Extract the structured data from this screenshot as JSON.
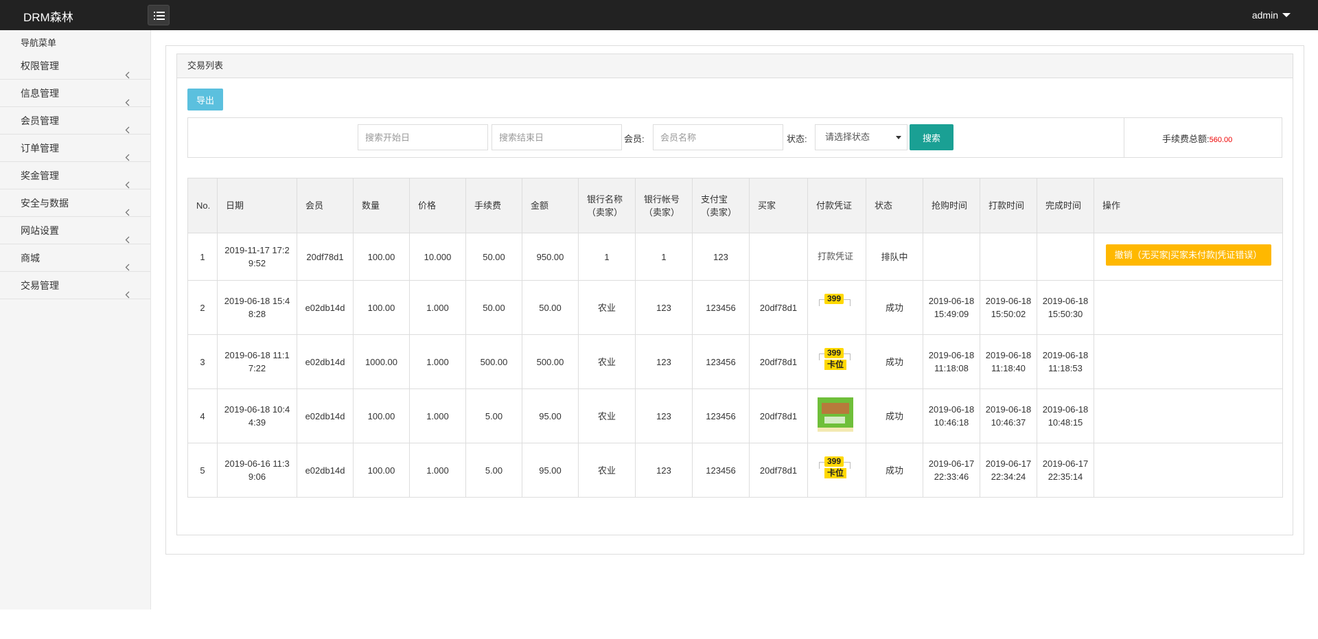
{
  "app": {
    "brand": "DRM森林",
    "user": "admin"
  },
  "sidebar": {
    "title": "导航菜单",
    "items": [
      {
        "label": "权限管理"
      },
      {
        "label": "信息管理"
      },
      {
        "label": "会员管理"
      },
      {
        "label": "订单管理"
      },
      {
        "label": "奖金管理"
      },
      {
        "label": "安全与数据"
      },
      {
        "label": "网站设置"
      },
      {
        "label": "商城"
      },
      {
        "label": "交易管理"
      }
    ]
  },
  "panel": {
    "title": "交易列表"
  },
  "toolbar": {
    "export_label": "导出"
  },
  "search": {
    "start_placeholder": "搜索开始日",
    "end_placeholder": "搜索结束日",
    "member_label": "会员:",
    "member_placeholder": "会员名称",
    "status_label": "状态:",
    "status_selected": "请选择状态",
    "search_label": "搜索",
    "fee_total_label": "手续费总额:",
    "fee_total_value": "560.00"
  },
  "table": {
    "headers": [
      "No.",
      "日期",
      "会员",
      "数量",
      "价格",
      "手续费",
      "金额",
      "银行名称（卖家）",
      "银行帐号（卖家）",
      "支付宝（卖家）",
      "买家",
      "付款凭证",
      "状态",
      "抢购时间",
      "打款时间",
      "完成时间",
      "操作"
    ],
    "rows": [
      {
        "no": "1",
        "date": "2019-11-17 17:29:52",
        "member": "20df78d1",
        "qty": "100.00",
        "price": "10.000",
        "fee": "50.00",
        "amount": "950.00",
        "bank": "1",
        "account": "1",
        "alipay": "123",
        "buyer": "",
        "voucher_alt": "打款凭证",
        "status": "排队中",
        "grab_time": "",
        "pay_time": "",
        "done_time": "",
        "action": "撤销（无买家|买家未付款|凭证错误）"
      },
      {
        "no": "2",
        "date": "2019-06-18 15:48:28",
        "member": "e02db14d",
        "qty": "100.00",
        "price": "1.000",
        "fee": "50.00",
        "amount": "50.00",
        "bank": "农业",
        "account": "123",
        "alipay": "123456",
        "buyer": "20df78d1",
        "voucher_tag": "399",
        "status": "成功",
        "grab_time": "2019-06-18 15:49:09",
        "pay_time": "2019-06-18 15:50:02",
        "done_time": "2019-06-18 15:50:30",
        "action": ""
      },
      {
        "no": "3",
        "date": "2019-06-18 11:17:22",
        "member": "e02db14d",
        "qty": "1000.00",
        "price": "1.000",
        "fee": "500.00",
        "amount": "500.00",
        "bank": "农业",
        "account": "123",
        "alipay": "123456",
        "buyer": "20df78d1",
        "voucher_tag": "399",
        "voucher_tag2": "卡位",
        "status": "成功",
        "grab_time": "2019-06-18 11:18:08",
        "pay_time": "2019-06-18 11:18:40",
        "done_time": "2019-06-18 11:18:53",
        "action": ""
      },
      {
        "no": "4",
        "date": "2019-06-18 10:44:39",
        "member": "e02db14d",
        "qty": "100.00",
        "price": "1.000",
        "fee": "5.00",
        "amount": "95.00",
        "bank": "农业",
        "account": "123",
        "alipay": "123456",
        "buyer": "20df78d1",
        "status": "成功",
        "grab_time": "2019-06-18 10:46:18",
        "pay_time": "2019-06-18 10:46:37",
        "done_time": "2019-06-18 10:48:15",
        "action": ""
      },
      {
        "no": "5",
        "date": "2019-06-16 11:39:06",
        "member": "e02db14d",
        "qty": "100.00",
        "price": "1.000",
        "fee": "5.00",
        "amount": "95.00",
        "bank": "农业",
        "account": "123",
        "alipay": "123456",
        "buyer": "20df78d1",
        "voucher_tag": "399",
        "voucher_tag2": "卡位",
        "status": "成功",
        "grab_time": "2019-06-17 22:33:46",
        "pay_time": "2019-06-17 22:34:24",
        "done_time": "2019-06-17 22:35:14",
        "action": ""
      }
    ]
  },
  "colors": {
    "topbar": "#222222",
    "export": "#5bc0de",
    "search": "#1aa094",
    "cancel": "#ffb800",
    "fee_value": "#ee0000"
  }
}
